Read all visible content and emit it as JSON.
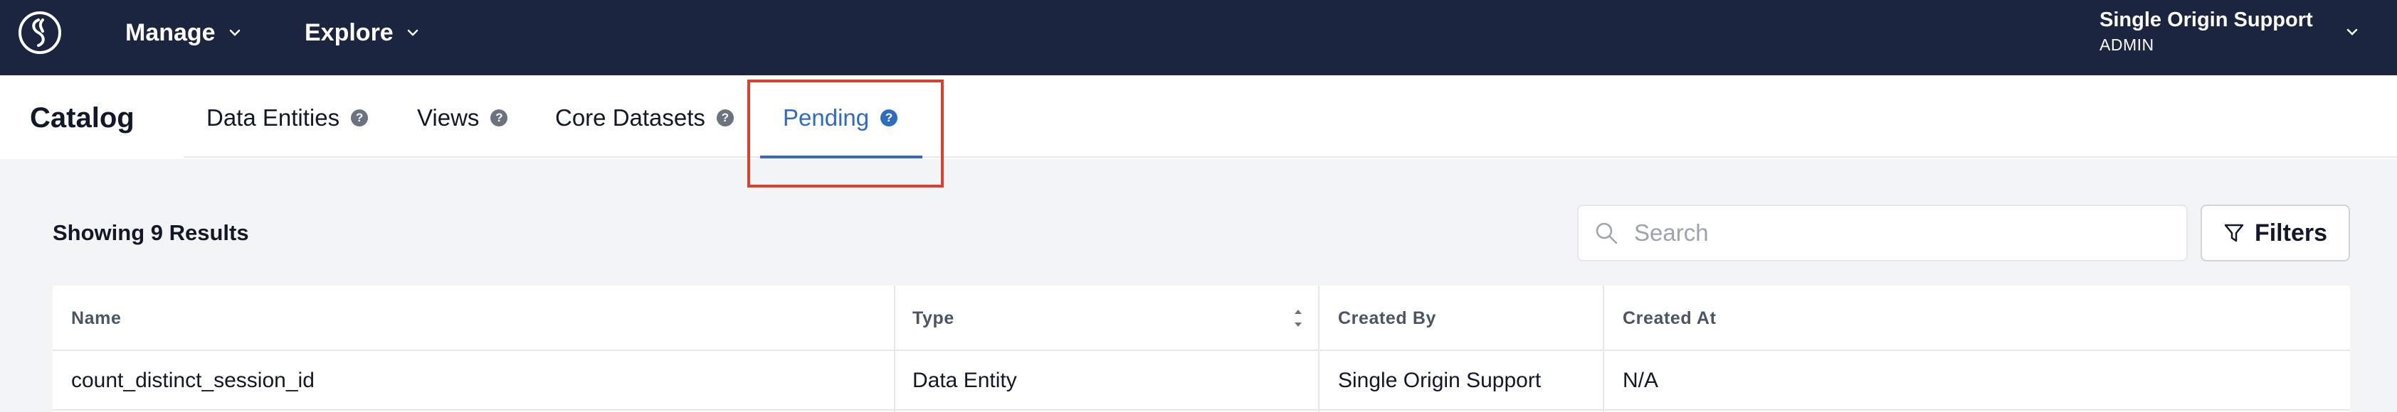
{
  "topbar": {
    "logo_icon": "swirl-logo-icon",
    "menus": [
      {
        "label": "Manage"
      },
      {
        "label": "Explore"
      }
    ],
    "user": {
      "name": "Single Origin Support",
      "role": "ADMIN"
    }
  },
  "page": {
    "title": "Catalog",
    "tabs": [
      {
        "label": "Data Entities",
        "active": false
      },
      {
        "label": "Views",
        "active": false
      },
      {
        "label": "Core Datasets",
        "active": false
      },
      {
        "label": "Pending",
        "active": true
      }
    ],
    "help_glyph": "?"
  },
  "results": {
    "summary": "Showing 9 Results",
    "search_placeholder": "Search",
    "filters_label": "Filters"
  },
  "table": {
    "columns": [
      "Name",
      "Type",
      "Created By",
      "Created At"
    ],
    "rows": [
      [
        "count_distinct_session_id",
        "Data Entity",
        "Single Origin Support",
        "N/A"
      ]
    ]
  },
  "colors": {
    "nav_bg": "#1b2540",
    "accent": "#2f6cc0",
    "highlight": "#d9412f"
  }
}
